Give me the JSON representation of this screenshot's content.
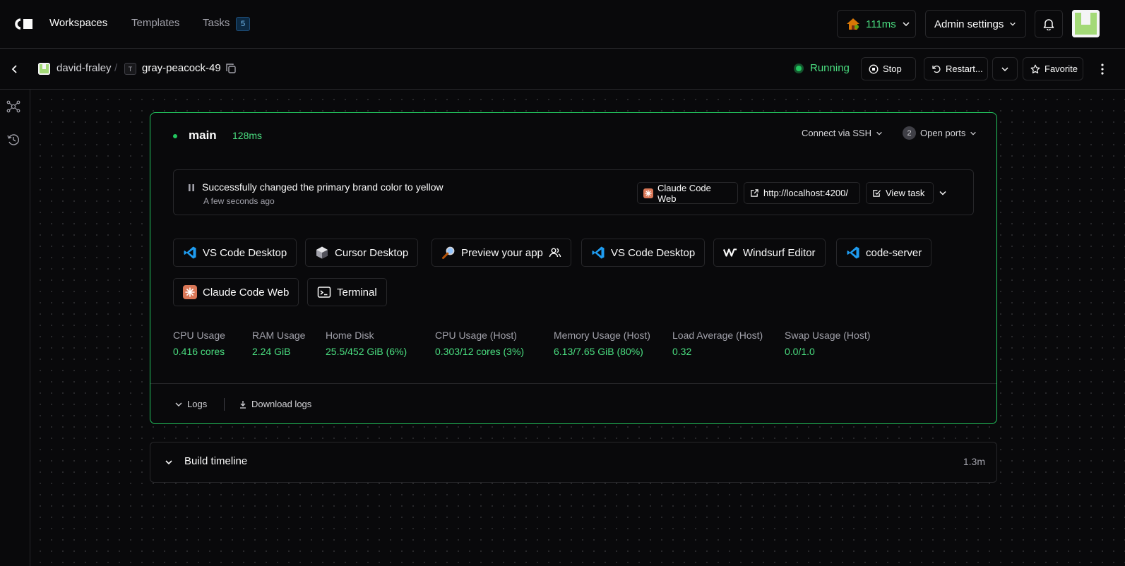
{
  "nav": {
    "workspaces": "Workspaces",
    "templates": "Templates",
    "tasks": "Tasks",
    "tasks_count": "5",
    "latency": "111ms",
    "admin_settings": "Admin settings"
  },
  "breadcrumb": {
    "user": "david-fraley",
    "separator": "/",
    "workspace_icon": "T",
    "workspace": "gray-peacock-49"
  },
  "workspace_actions": {
    "status": "Running",
    "stop": "Stop",
    "restart": "Restart...",
    "favorite": "Favorite"
  },
  "agent": {
    "name": "main",
    "latency": "128ms",
    "connect_ssh": "Connect via SSH",
    "open_ports_count": "2",
    "open_ports": "Open ports",
    "task": {
      "message": "Successfully changed the primary brand color to yellow",
      "time": "A few seconds ago",
      "app": "Claude Code Web",
      "link": "http://localhost:4200/",
      "view_task": "View task"
    },
    "apps": [
      {
        "label": "VS Code Desktop",
        "icon": "vscode-icon"
      },
      {
        "label": "Cursor Desktop",
        "icon": "cursor-icon"
      },
      {
        "label": "Preview your app",
        "icon": "magnifier-icon"
      },
      {
        "label": "VS Code Desktop",
        "icon": "vscode-icon"
      },
      {
        "label": "Windsurf Editor",
        "icon": "windsurf-icon"
      },
      {
        "label": "code-server",
        "icon": "vscode-icon"
      },
      {
        "label": "Claude Code Web",
        "icon": "claude-icon"
      },
      {
        "label": "Terminal",
        "icon": "terminal-icon"
      }
    ],
    "metrics": [
      {
        "label": "CPU Usage",
        "value": "0.416 cores"
      },
      {
        "label": "RAM Usage",
        "value": "2.24 GiB"
      },
      {
        "label": "Home Disk",
        "value": "25.5/452 GiB (6%)"
      },
      {
        "label": "CPU Usage (Host)",
        "value": "0.303/12 cores (3%)"
      },
      {
        "label": "Memory Usage (Host)",
        "value": "6.13/7.65 GiB (80%)"
      },
      {
        "label": "Load Average (Host)",
        "value": "0.32"
      },
      {
        "label": "Swap Usage (Host)",
        "value": "0.0/1.0"
      }
    ],
    "logs": "Logs",
    "download_logs": "Download logs"
  },
  "build_timeline": {
    "title": "Build timeline",
    "duration": "1.3m"
  },
  "colors": {
    "background": "#09090b",
    "border": "#27272a",
    "success": "#4ade80",
    "accent_green": "#22c55e"
  }
}
